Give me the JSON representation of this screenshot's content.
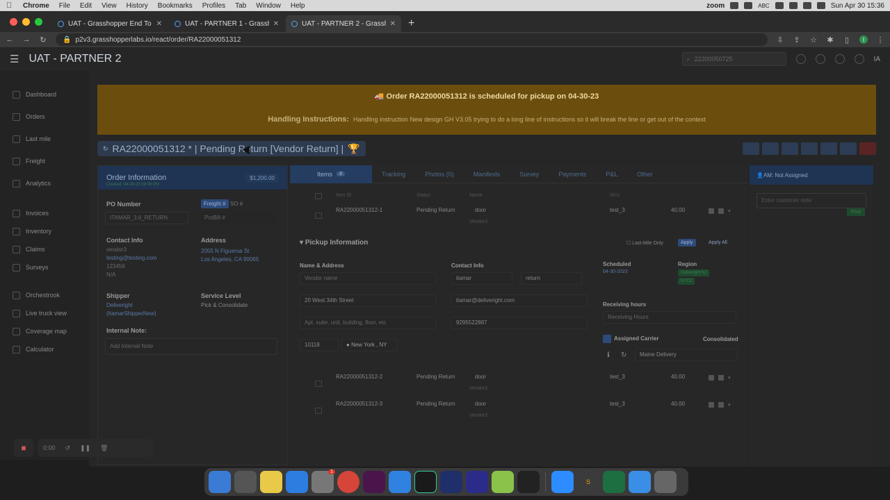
{
  "macos": {
    "app": "Chrome",
    "menus": [
      "File",
      "Edit",
      "View",
      "History",
      "Bookmarks",
      "Profiles",
      "Tab",
      "Window",
      "Help"
    ],
    "zoom": "zoom",
    "input_source": "ABC",
    "datetime": "Sun Apr 30  15:36"
  },
  "browser": {
    "tabs": [
      {
        "label": "UAT - Grasshopper End To End"
      },
      {
        "label": "UAT - PARTNER 1 - Grasshopp"
      },
      {
        "label": "UAT - PARTNER 2 - Grassh"
      }
    ],
    "url": "p2v3.grasshopperlabs.io/react/order/RA22000051312",
    "profile_initial": "I"
  },
  "app": {
    "title": "UAT - PARTNER 2",
    "search_value": "22200050725",
    "avatar": "IA"
  },
  "sidebar": {
    "groups": [
      [
        "Dashboard",
        "Orders",
        "Last mile",
        "Freight",
        "Analytics"
      ],
      [
        "Invoices",
        "Inventory",
        "Claims",
        "Surveys"
      ],
      [
        "Orchestrook",
        "Live truck view",
        "Coverage map",
        "Calculator"
      ]
    ]
  },
  "banner": {
    "schedule": "Order RA22000051312 is scheduled for pickup on 04-30-23",
    "handling_label": "Handling Instructions:",
    "handling_text": "Handling instruction New design GH V3.05 trying to do a long line of instructions so it will break the line or get out of the context"
  },
  "order": {
    "title": "RA22000051312 * | Pending Return [Vendor Return] |",
    "panel_title": "Order Information",
    "amount": "$1,200.00",
    "created": "Created: 04-30-23 08:08 PM",
    "po_label": "PO Number",
    "po_value": "ITAMAR_3.6_RETURN",
    "freight_toggle": "Freight #",
    "so_toggle": "SO #",
    "probill_placeholder": "ProBill #",
    "contact_label": "Contact Info",
    "contact_name": "vendor3",
    "contact_email": "testing@testing.com",
    "contact_phone": "123456",
    "contact_extra": "N/A",
    "address_label": "Address",
    "address_line1": "2055 N Figueroa St",
    "address_line2": "Los Angeles, CA 90065",
    "shipper_label": "Shipper",
    "shipper_name": "Deliveright",
    "shipper_sub": "(ItamarShipperNew)",
    "service_label": "Service Level",
    "service_value": "Pick & Consolidate",
    "internal_label": "Internal Note:",
    "internal_placeholder": "Add Internal Note"
  },
  "tabs": [
    {
      "label": "Items",
      "count": "3"
    },
    {
      "label": "Tracking"
    },
    {
      "label": "Photos (0)"
    },
    {
      "label": "Manifests"
    },
    {
      "label": "Survey"
    },
    {
      "label": "Payments"
    },
    {
      "label": "P&L"
    },
    {
      "label": "Other"
    }
  ],
  "items_table": {
    "headers": [
      "Item ID",
      "Status",
      "Name",
      "SKU"
    ],
    "rows": [
      {
        "id": "RA22000051312-1",
        "status": "Pending Return",
        "name": "door",
        "vendor": "Vendor3",
        "sku": "test_3",
        "value": "40.00"
      },
      {
        "id": "RA22000051312-2",
        "status": "Pending Return",
        "name": "door",
        "vendor": "Vendor3",
        "sku": "test_3",
        "value": "40.00"
      },
      {
        "id": "RA22000051312-3",
        "status": "Pending Return",
        "name": "door",
        "vendor": "Vendor3",
        "sku": "test_3",
        "value": "40.00"
      }
    ]
  },
  "pickup": {
    "title": "Pickup Information",
    "last_mile": "Last-Mile Only",
    "apply": "Apply",
    "apply_all": "Apply All",
    "name_addr_label": "Name & Address",
    "vendor_placeholder": "Vendor name",
    "street": "20 West 34th Street",
    "apt_placeholder": "Apt, suite, unit, building, floor, etc",
    "zip": "10118",
    "city": "New York , NY",
    "contact_label": "Contact Info",
    "first_name": "itamar",
    "last_name": "return",
    "email": "itamar@deliveright.com",
    "phone": "9295522887",
    "scheduled_label": "Scheduled",
    "scheduled_date": "04-30-2023",
    "region_label": "Region",
    "region_tag": "Deliveright NJ",
    "region_sub": "NYC2",
    "receiving_label": "Receiving hours",
    "receiving_placeholder": "Receiving Hours",
    "carrier_label": "Assigned Carrier",
    "consolidated": "Consolidated",
    "carrier_value": "Maine Delivery"
  },
  "right_panel": {
    "am": "AM: Not Assigned",
    "note_placeholder": "Enter customer note",
    "post": "Post"
  },
  "recorder": {
    "time": "0:00"
  },
  "colors": {
    "banner_bg": "#6b4e0e",
    "primary_blue": "#1f3352",
    "freight_toggle": "#2e4a7a"
  }
}
